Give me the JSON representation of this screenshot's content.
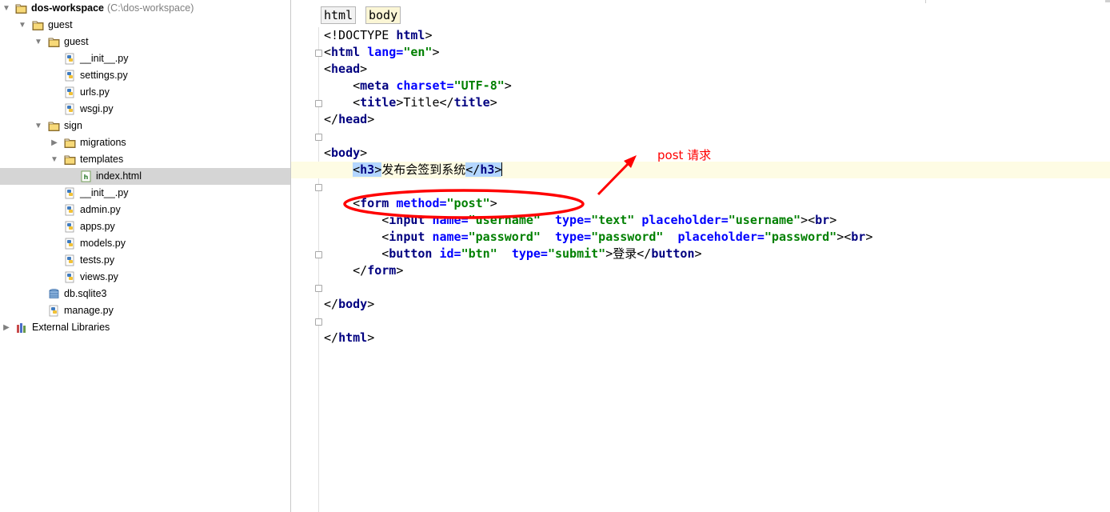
{
  "project": {
    "root_name": "dos-workspace",
    "root_path": "(C:\\dos-workspace)",
    "items": [
      {
        "label": "guest",
        "type": "folder",
        "depth": 1,
        "expanded": true
      },
      {
        "label": "guest",
        "type": "folder",
        "depth": 2,
        "expanded": true
      },
      {
        "label": "__init__.py",
        "type": "python",
        "depth": 3
      },
      {
        "label": "settings.py",
        "type": "python",
        "depth": 3
      },
      {
        "label": "urls.py",
        "type": "python",
        "depth": 3
      },
      {
        "label": "wsgi.py",
        "type": "python",
        "depth": 3
      },
      {
        "label": "sign",
        "type": "folder",
        "depth": 2,
        "expanded": true
      },
      {
        "label": "migrations",
        "type": "folder",
        "depth": 3,
        "expanded": false
      },
      {
        "label": "templates",
        "type": "folder",
        "depth": 3,
        "expanded": true
      },
      {
        "label": "index.html",
        "type": "html",
        "depth": 4,
        "selected": true
      },
      {
        "label": "__init__.py",
        "type": "python",
        "depth": 3
      },
      {
        "label": "admin.py",
        "type": "python",
        "depth": 3
      },
      {
        "label": "apps.py",
        "type": "python",
        "depth": 3
      },
      {
        "label": "models.py",
        "type": "python",
        "depth": 3
      },
      {
        "label": "tests.py",
        "type": "python",
        "depth": 3
      },
      {
        "label": "views.py",
        "type": "python",
        "depth": 3
      },
      {
        "label": "db.sqlite3",
        "type": "database",
        "depth": 2
      },
      {
        "label": "manage.py",
        "type": "python",
        "depth": 2
      },
      {
        "label": "External Libraries",
        "type": "library",
        "depth": 0,
        "expanded": false
      }
    ]
  },
  "editor": {
    "breadcrumbs": [
      "html",
      "body"
    ],
    "current_line": 9,
    "lines": [
      [
        {
          "t": "<!DOCTYPE "
        },
        {
          "t": "html",
          "c": "tg"
        },
        {
          "t": ">"
        }
      ],
      [
        {
          "t": "<"
        },
        {
          "t": "html",
          "c": "tg"
        },
        {
          "t": " "
        },
        {
          "t": "lang=",
          "c": "at"
        },
        {
          "t": "\"en\"",
          "c": "sv"
        },
        {
          "t": ">"
        }
      ],
      [
        {
          "t": "<"
        },
        {
          "t": "head",
          "c": "tg"
        },
        {
          "t": ">"
        }
      ],
      [
        {
          "t": "    <"
        },
        {
          "t": "meta",
          "c": "tg"
        },
        {
          "t": " "
        },
        {
          "t": "charset=",
          "c": "at"
        },
        {
          "t": "\"UTF-8\"",
          "c": "sv"
        },
        {
          "t": ">"
        }
      ],
      [
        {
          "t": "    <"
        },
        {
          "t": "title",
          "c": "tg"
        },
        {
          "t": ">Title</"
        },
        {
          "t": "title",
          "c": "tg"
        },
        {
          "t": ">"
        }
      ],
      [
        {
          "t": "</"
        },
        {
          "t": "head",
          "c": "tg"
        },
        {
          "t": ">"
        }
      ],
      [],
      [
        {
          "t": "<"
        },
        {
          "t": "body",
          "c": "tg"
        },
        {
          "t": ">"
        }
      ],
      [
        {
          "t": "    "
        },
        {
          "t": "<",
          "h": 1
        },
        {
          "t": "h3",
          "c": "tg",
          "h": 1
        },
        {
          "t": ">",
          "h": 1
        },
        {
          "t": "发布会签到系统"
        },
        {
          "t": "</",
          "h": 1
        },
        {
          "t": "h3",
          "c": "tg",
          "h": 1
        },
        {
          "t": ">",
          "h": 1
        },
        {
          "caret": true
        }
      ],
      [],
      [
        {
          "t": "    <"
        },
        {
          "t": "form",
          "c": "tg"
        },
        {
          "t": " "
        },
        {
          "t": "method=",
          "c": "at"
        },
        {
          "t": "\"post\"",
          "c": "sv"
        },
        {
          "t": ">"
        }
      ],
      [
        {
          "t": "        <"
        },
        {
          "t": "input",
          "c": "tg"
        },
        {
          "t": " "
        },
        {
          "t": "name=",
          "c": "at"
        },
        {
          "t": "\"username\"",
          "c": "sv"
        },
        {
          "t": "  "
        },
        {
          "t": "type=",
          "c": "at"
        },
        {
          "t": "\"text\"",
          "c": "sv"
        },
        {
          "t": " "
        },
        {
          "t": "placeholder=",
          "c": "at"
        },
        {
          "t": "\"username\"",
          "c": "sv"
        },
        {
          "t": "><"
        },
        {
          "t": "br",
          "c": "tg"
        },
        {
          "t": ">"
        }
      ],
      [
        {
          "t": "        <"
        },
        {
          "t": "input",
          "c": "tg"
        },
        {
          "t": " "
        },
        {
          "t": "name=",
          "c": "at"
        },
        {
          "t": "\"password\"",
          "c": "sv"
        },
        {
          "t": "  "
        },
        {
          "t": "type=",
          "c": "at"
        },
        {
          "t": "\"password\"",
          "c": "sv"
        },
        {
          "t": "  "
        },
        {
          "t": "placeholder=",
          "c": "at"
        },
        {
          "t": "\"password\"",
          "c": "sv"
        },
        {
          "t": "><"
        },
        {
          "t": "br",
          "c": "tg"
        },
        {
          "t": ">"
        }
      ],
      [
        {
          "t": "        <"
        },
        {
          "t": "button",
          "c": "tg"
        },
        {
          "t": " "
        },
        {
          "t": "id=",
          "c": "at"
        },
        {
          "t": "\"btn\"",
          "c": "sv"
        },
        {
          "t": "  "
        },
        {
          "t": "type=",
          "c": "at"
        },
        {
          "t": "\"submit\"",
          "c": "sv"
        },
        {
          "t": ">登录</"
        },
        {
          "t": "button",
          "c": "tg"
        },
        {
          "t": ">"
        }
      ],
      [
        {
          "t": "    </"
        },
        {
          "t": "form",
          "c": "tg"
        },
        {
          "t": ">"
        }
      ],
      [],
      [
        {
          "t": "</"
        },
        {
          "t": "body",
          "c": "tg"
        },
        {
          "t": ">"
        }
      ],
      [],
      [
        {
          "t": "</"
        },
        {
          "t": "html",
          "c": "tg"
        },
        {
          "t": ">"
        }
      ]
    ]
  },
  "annotation": {
    "text": "post 请求",
    "color": "#ff0000"
  },
  "colors": {
    "tag": "#000080",
    "attribute": "#0000ff",
    "string": "#008000",
    "current_line": "#fefce4",
    "tag_match": "#b4d7ff",
    "selected_row": "#d5d5d5"
  }
}
